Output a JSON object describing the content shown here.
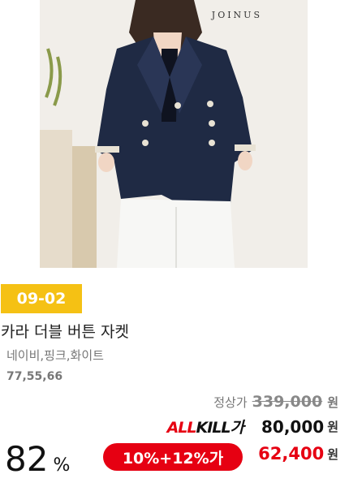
{
  "product": {
    "brand": "JOINUS",
    "image_alt": "navy double-button jacket on model",
    "date_badge": "09-02",
    "name": "카라 더블 버튼 자켓",
    "colors": "네이비,핑크,화이트",
    "sizes": "77,55,66"
  },
  "pricing": {
    "regular_label": "정상가",
    "regular_price": "339,000",
    "allkill_logo_part1": "ALL",
    "allkill_logo_part2": "KILL가",
    "allkill_price": "80,000",
    "discount_percent": "82",
    "discount_unit": "%",
    "coupon_label": "10%+12%가",
    "final_price": "62,400",
    "currency": "원"
  },
  "colors": {
    "badge_yellow": "#f5c114",
    "accent_red": "#e60012",
    "jacket_navy": "#1f2a44"
  }
}
